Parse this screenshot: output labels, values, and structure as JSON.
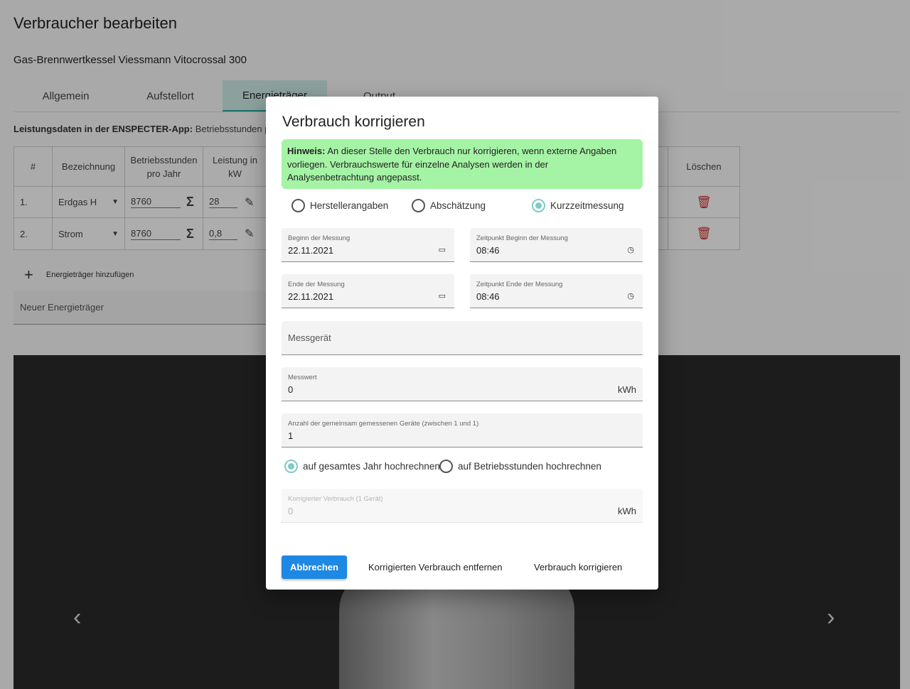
{
  "page": {
    "title": "Verbraucher bearbeiten",
    "subtitle": "Gas-Brennwertkessel Viessmann Vitocrossal 300",
    "tabs": [
      "Allgemein",
      "Aufstellort",
      "Energieträger",
      "Output"
    ],
    "active_tab": "Energieträger",
    "leistung_bold": "Leistungsdaten in der ENSPECTER-App:",
    "leistung_rest": " Betriebsstunden pro J",
    "table": {
      "headers": [
        "#",
        "Bezeichnung",
        "Betriebsstunden pro Jahr",
        "Leistung in kW",
        "Löschen"
      ],
      "rows": [
        {
          "num": "1.",
          "name": "Erdgas H",
          "hours": "8760",
          "power": "28"
        },
        {
          "num": "2.",
          "name": "Strom",
          "hours": "8760",
          "power": "0,8"
        }
      ]
    },
    "add_label": "Energieträger hinzufügen",
    "new_input_placeholder": "Neuer Energieträger"
  },
  "dialog": {
    "title": "Verbrauch korrigieren",
    "hint_bold": "Hinweis:",
    "hint_text": " An dieser Stelle den Verbrauch nur korrigieren, wenn externe Angaben vorliegen. Verbrauchswerte für einzelne Analysen werden in der Analysenbetrachtung angepasst.",
    "source_options": [
      "Herstellerangaben",
      "Abschätzung",
      "Kurzzeitmessung"
    ],
    "source_selected": "Kurzzeitmessung",
    "begin_date": {
      "label": "Beginn der Messung",
      "value": "22.11.2021"
    },
    "begin_time": {
      "label": "Zeitpunkt Beginn der Messung",
      "value": "08:46"
    },
    "end_date": {
      "label": "Ende der Messung",
      "value": "22.11.2021"
    },
    "end_time": {
      "label": "Zeitpunkt Ende der Messung",
      "value": "08:46"
    },
    "device": {
      "placeholder": "Messgerät"
    },
    "measured": {
      "label": "Messwert",
      "value": "0",
      "unit": "kWh"
    },
    "count": {
      "label": "Anzahl der gemeinsam gemessenen Geräte (zwischen 1 und 1)",
      "value": "1"
    },
    "extrapolate_options": [
      "auf gesamtes Jahr hochrechnen",
      "auf Betriebsstunden hochrechnen"
    ],
    "extrapolate_selected": "auf gesamtes Jahr hochrechnen",
    "corrected": {
      "label": "Korrigierter Verbrauch (1 Gerät)",
      "value": "0",
      "unit": "kWh"
    },
    "buttons": {
      "cancel": "Abbrechen",
      "remove": "Korrigierten Verbrauch entfernen",
      "apply": "Verbrauch korrigieren"
    }
  },
  "colors": {
    "accent": "#80cbc4",
    "primary_button": "#1e88e5",
    "hint_bg": "#a5f3a5",
    "delete": "#d32f2f"
  }
}
